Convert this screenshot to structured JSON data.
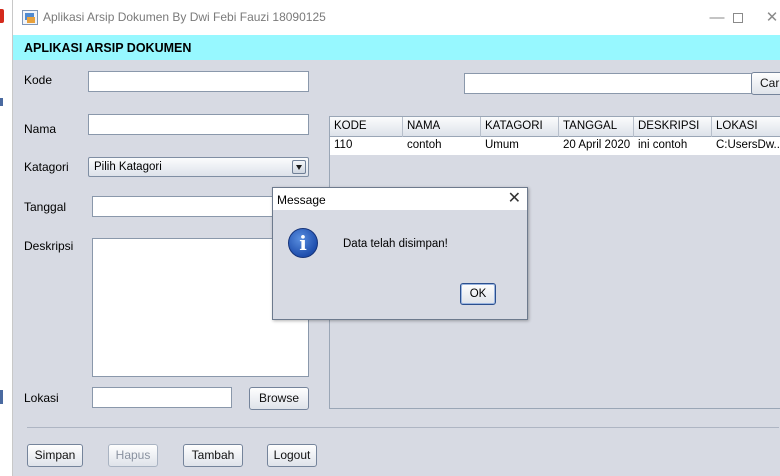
{
  "window": {
    "title": "Aplikasi Arsip Dokumen By Dwi Febi Fauzi 18090125",
    "controls": {
      "minimize": "—",
      "close": "✕"
    }
  },
  "header": {
    "title": "APLIKASI ARSIP DOKUMEN"
  },
  "form": {
    "kode_label": "Kode",
    "kode_value": "",
    "nama_label": "Nama",
    "nama_value": "",
    "katagori_label": "Katagori",
    "katagori_selected": "Pilih Katagori",
    "tanggal_label": "Tanggal",
    "tanggal_value": "",
    "deskripsi_label": "Deskripsi",
    "deskripsi_value": "",
    "lokasi_label": "Lokasi",
    "lokasi_value": "",
    "browse_label": "Browse"
  },
  "search": {
    "value": "",
    "button_label": "Cari"
  },
  "table": {
    "columns": [
      "KODE",
      "NAMA",
      "KATAGORI",
      "TANGGAL",
      "DESKRIPSI",
      "LOKASI"
    ],
    "rows": [
      [
        "110",
        "contoh",
        "Umum",
        "20 April 2020",
        "ini contoh",
        "C:UsersDw..."
      ]
    ]
  },
  "actions": {
    "simpan": "Simpan",
    "hapus": "Hapus",
    "tambah": "Tambah",
    "logout": "Logout"
  },
  "dialog": {
    "title": "Message",
    "close": "✕",
    "icon": "info-icon",
    "message": "Data telah disimpan!",
    "ok_label": "OK"
  },
  "colors": {
    "header_band": "#97f8ff",
    "panel_bg": "#d7dae3"
  }
}
